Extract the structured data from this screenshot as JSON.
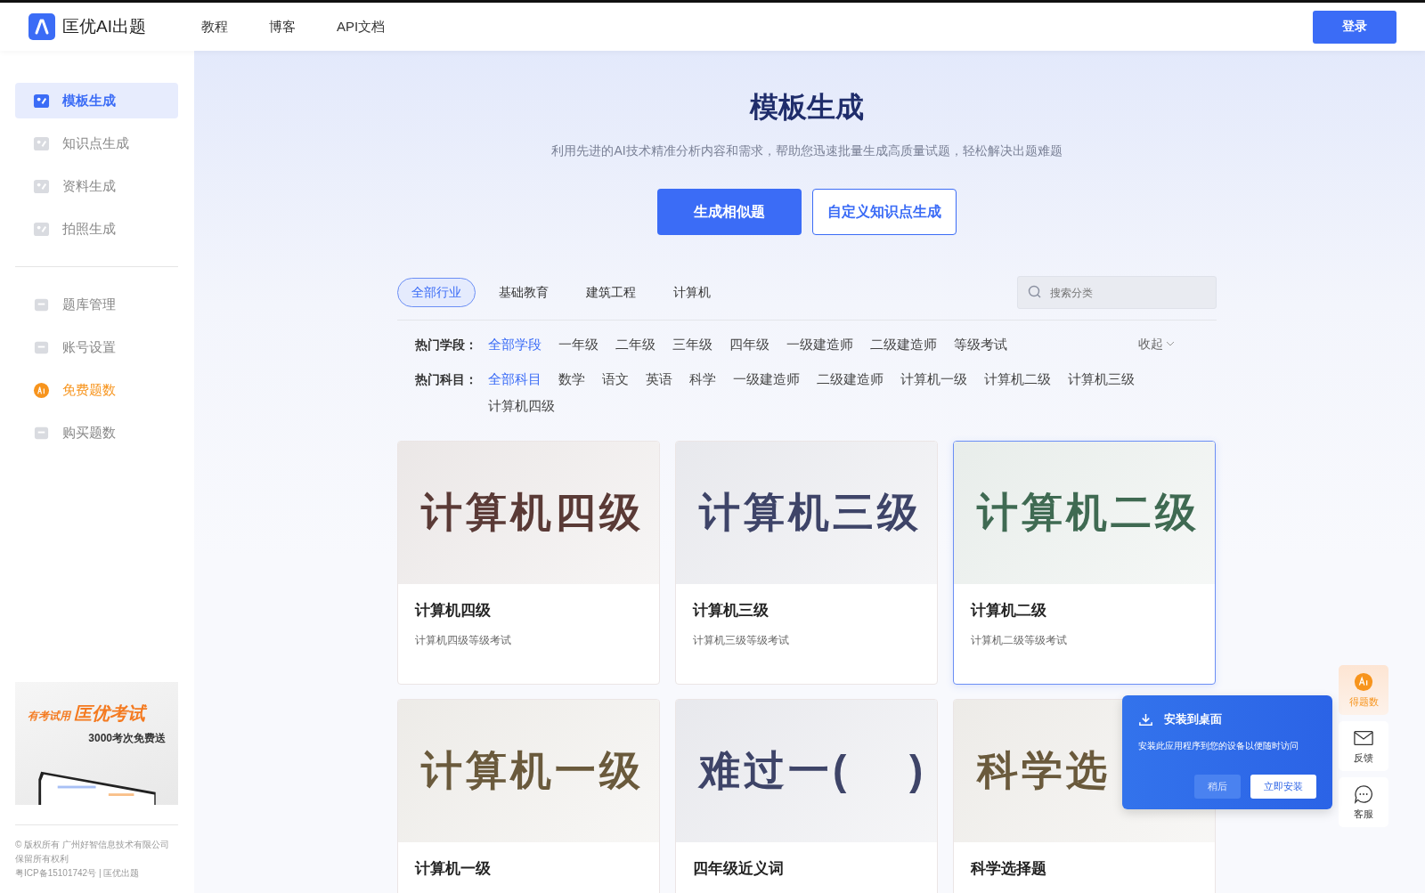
{
  "header": {
    "logo_text": "匡优AI出题",
    "nav": [
      {
        "label": "教程"
      },
      {
        "label": "博客"
      },
      {
        "label": "API文档"
      }
    ],
    "login_button": "登录"
  },
  "sidebar": {
    "items": [
      {
        "label": "模板生成",
        "selected": true,
        "kind": "normal"
      },
      {
        "label": "知识点生成",
        "selected": false,
        "kind": "normal"
      },
      {
        "label": "资料生成",
        "selected": false,
        "kind": "normal"
      },
      {
        "label": "拍照生成",
        "selected": false,
        "kind": "normal"
      }
    ],
    "items_2": [
      {
        "label": "题库管理",
        "selected": false,
        "kind": "normal"
      },
      {
        "label": "账号设置",
        "selected": false,
        "kind": "normal"
      },
      {
        "label": "免费题数",
        "selected": false,
        "kind": "promo"
      },
      {
        "label": "购买题数",
        "selected": false,
        "kind": "normal"
      }
    ],
    "banner": {
      "tagline": "有考试用",
      "brand": "匡优考试",
      "offer": "3000考次免费送"
    },
    "footer": [
      "© 版权所有 广州好智信息技术有限公司",
      "保留所有权利",
      "粤ICP备15101742号 | 匡优出题"
    ]
  },
  "hero": {
    "title": "模板生成",
    "subtitle": "利用先进的AI技术精准分析内容和需求，帮助您迅速批量生成高质量试题，轻松解决出题难题",
    "primary_button": "生成相似题",
    "secondary_button": "自定义知识点生成"
  },
  "tabs": [
    {
      "label": "全部行业",
      "selected": true
    },
    {
      "label": "基础教育",
      "selected": false
    },
    {
      "label": "建筑工程",
      "selected": false
    },
    {
      "label": "计算机",
      "selected": false
    }
  ],
  "search": {
    "placeholder": "搜索分类"
  },
  "filters": [
    {
      "label": "热门学段：",
      "options": [
        {
          "label": "全部学段",
          "selected": true
        },
        {
          "label": "一年级",
          "selected": false
        },
        {
          "label": "二年级",
          "selected": false
        },
        {
          "label": "三年级",
          "selected": false
        },
        {
          "label": "四年级",
          "selected": false
        },
        {
          "label": "一级建造师",
          "selected": false
        },
        {
          "label": "二级建造师",
          "selected": false
        },
        {
          "label": "等级考试",
          "selected": false
        }
      ],
      "toggle": "收起"
    },
    {
      "label": "热门科目：",
      "options": [
        {
          "label": "全部科目",
          "selected": true
        },
        {
          "label": "数学",
          "selected": false
        },
        {
          "label": "语文",
          "selected": false
        },
        {
          "label": "英语",
          "selected": false
        },
        {
          "label": "科学",
          "selected": false
        },
        {
          "label": "一级建造师",
          "selected": false
        },
        {
          "label": "二级建造师",
          "selected": false
        },
        {
          "label": "计算机一级",
          "selected": false
        },
        {
          "label": "计算机二级",
          "selected": false
        },
        {
          "label": "计算机三级",
          "selected": false
        },
        {
          "label": "计算机四级",
          "selected": false
        }
      ]
    }
  ],
  "cards": [
    {
      "banner_text": "计算机四级",
      "title": "计算机四级",
      "description": "计算机四级等级考试",
      "color": "#5a3a36",
      "selected": false
    },
    {
      "banner_text": "计算机三级",
      "title": "计算机三级",
      "description": "计算机三级等级考试",
      "color": "#3e4468",
      "selected": false
    },
    {
      "banner_text": "计算机二级",
      "title": "计算机二级",
      "description": "计算机二级等级考试",
      "color": "#3f6a52",
      "selected": true
    },
    {
      "banner_text": "计算机一级",
      "title": "计算机一级",
      "color": "#6a5a3c",
      "selected": false
    },
    {
      "banner_text": "难过一(　 )",
      "title": "四年级近义词",
      "color": "#3e4468",
      "selected": false
    },
    {
      "banner_text": "科学选",
      "title": "科学选择题",
      "color": "#6a5a3c",
      "selected": false
    }
  ],
  "install_popup": {
    "title": "安装到桌面",
    "message": "安装此应用程序到您的设备以便随时访问",
    "later_button": "稍后",
    "install_button": "立即安装"
  },
  "float_tools": [
    {
      "label": "得题数",
      "kind": "promo"
    },
    {
      "label": "反馈",
      "kind": "feedback"
    },
    {
      "label": "客服",
      "kind": "service"
    }
  ]
}
